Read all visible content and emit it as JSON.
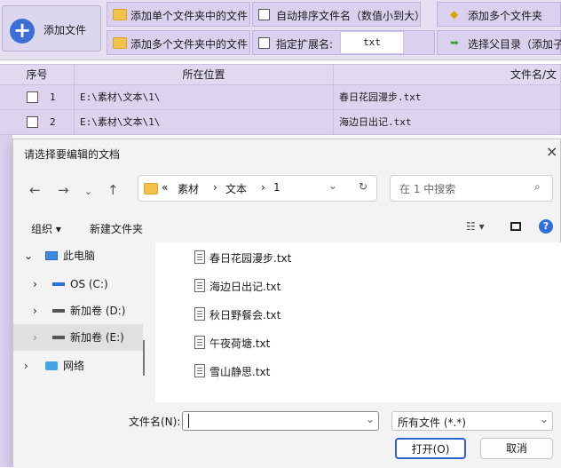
{
  "toolbar": {
    "add_file": "添加文件",
    "add_single_folder": "添加单个文件夹中的文件",
    "add_multi_folder_1": "添加多个文件夹中的文件",
    "add_multi_folder_2": "添加多个文件夹",
    "auto_sort": "自动排序文件名（数值小到大）",
    "ext_label": "指定扩展名:",
    "ext_value": "txt",
    "choose_parent": "选择父目录（添加子"
  },
  "table": {
    "headers": [
      "序号",
      "所在位置",
      "文件名/文"
    ],
    "rows": [
      {
        "index": "1",
        "path": "E:\\素材\\文本\\1\\",
        "name": "春日花园漫步.txt"
      },
      {
        "index": "2",
        "path": "E:\\素材\\文本\\1\\",
        "name": "海边日出记.txt"
      }
    ]
  },
  "dialog": {
    "title": "请选择要编辑的文档",
    "close": "×",
    "address": [
      "«",
      "素材",
      "›",
      "文本",
      "›",
      "1"
    ],
    "search_placeholder": "在 1 中搜索",
    "organize": "组织 ▾",
    "new_folder": "新建文件夹",
    "nav": [
      {
        "label": "此电脑"
      },
      {
        "label": "OS (C:)"
      },
      {
        "label": "新加卷 (D:)"
      },
      {
        "label": "新加卷 (E:)"
      },
      {
        "label": "网络"
      }
    ],
    "files": [
      "春日花园漫步.txt",
      "海边日出记.txt",
      "秋日野餐会.txt",
      "午夜荷塘.txt",
      "雪山静思.txt"
    ],
    "filename_label": "文件名(N):",
    "filename_value": "",
    "filter": "所有文件 (*.*)",
    "open": "打开(O)",
    "cancel": "取消"
  }
}
